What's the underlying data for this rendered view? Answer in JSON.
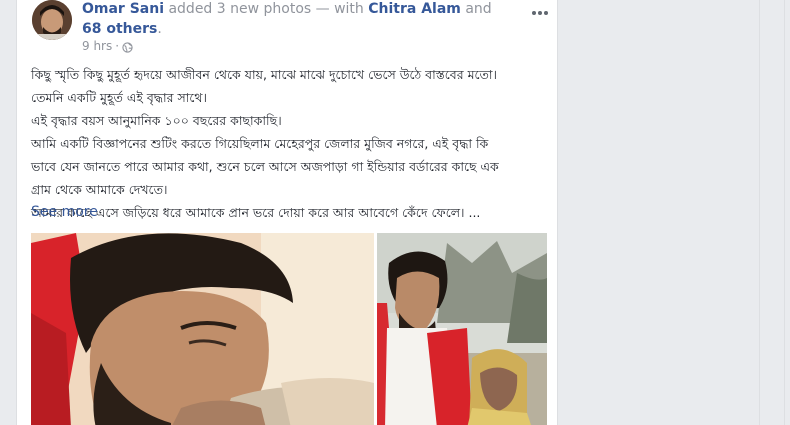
{
  "post": {
    "author": "Omar Sani",
    "action": " added 3 new photos — with ",
    "tagged_person": "Chitra Alam",
    "and_text": " and ",
    "others_link": "68 others",
    "period": ".",
    "timestamp": "9 hrs",
    "separator": " · ",
    "privacy_icon": "globe-icon",
    "options_icon": "more-options-icon",
    "body_lines": [
      "কিছু স্মৃতি কিছু মুহূর্ত হৃদয়ে আজীবন থেকে যায়, মাঝে মাঝে দুচোখে ভেসে উঠে বাস্তবের মতো।",
      "তেমনি একটি মুহূর্ত এই বৃদ্ধার সাথে।",
      "এই বৃদ্ধার বয়স আনুমানিক ১০০ বছরের কাছাকাছি।",
      "আমি একটি বিজ্ঞাপনের শুটিং করতে গিয়েছিলাম মেহেরপুর জেলার মুজিব নগরে, এই বৃদ্ধা কি",
      "ভাবে যেন জানতে পারে আমার কথা, শুনে চলে আসে অজপাড়া গা ইন্ডিয়ার বর্ডারের কাছে এক",
      "গ্রাম থেকে আমাকে দেখতে।",
      "আমার কাছে এসে জড়িয়ে ধরে আমাকে প্রান ভরে দোয়া করে আর আবেগে কেঁদে ফেলে। ..."
    ],
    "see_more": "See more"
  },
  "colors": {
    "link": "#365899",
    "meta": "#90949c",
    "text": "#1d2129",
    "background": "#e9ebee",
    "card": "#ffffff"
  }
}
